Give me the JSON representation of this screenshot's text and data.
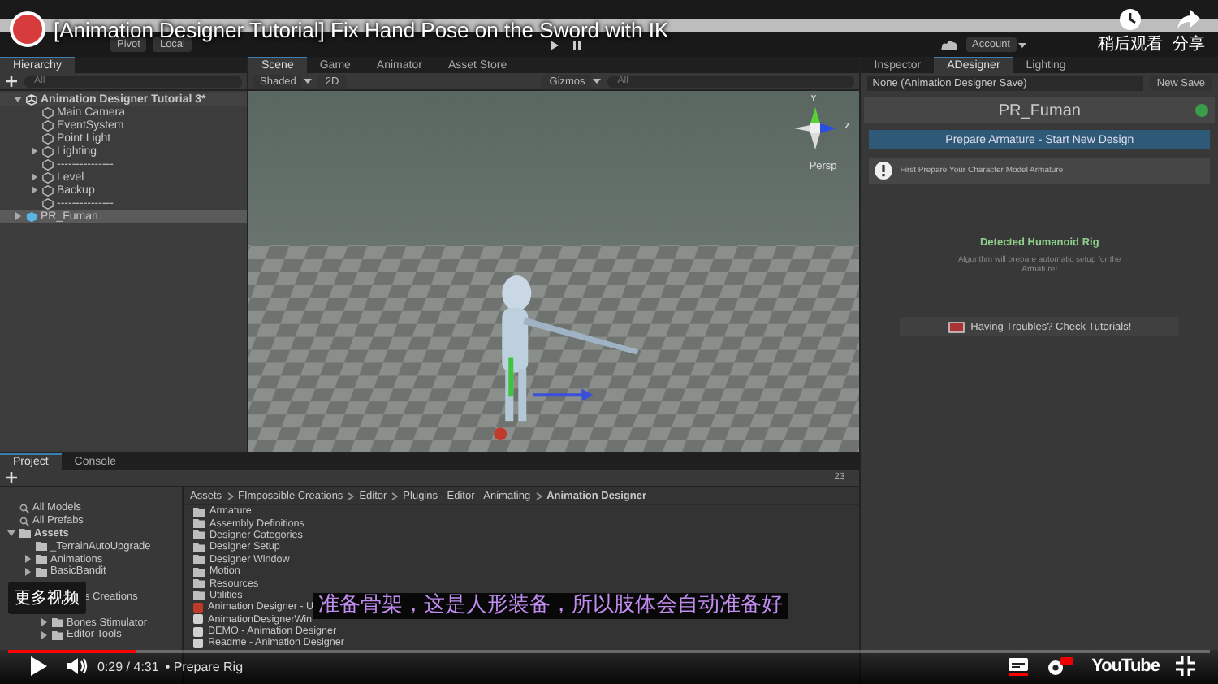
{
  "video_title": "[Animation Designer Tutorial] Fix Hand Pose on the Sword with IK",
  "top_actions": [
    {
      "kind": "watch_later",
      "label": "稍后观看"
    },
    {
      "kind": "share",
      "label": "分享"
    }
  ],
  "toolbar": {
    "pivot": "Pivot",
    "local": "Local",
    "account": "Account"
  },
  "hierarchy": {
    "tab": "Hierarchy",
    "search": "All",
    "items": [
      {
        "label": "Animation Designer Tutorial 3*",
        "kind": "scene",
        "expanded": true,
        "selected": false,
        "children": [
          {
            "label": "Main Camera",
            "kind": "object",
            "selected": false
          },
          {
            "label": "EventSystem",
            "kind": "object",
            "selected": false
          },
          {
            "label": "Point Light",
            "kind": "object",
            "selected": false
          },
          {
            "label": "Lighting",
            "kind": "object",
            "expanded": false,
            "selected": false
          },
          {
            "label": "---------------",
            "kind": "object",
            "selected": false
          },
          {
            "label": "Level",
            "kind": "object",
            "expanded": false,
            "selected": false
          },
          {
            "label": "Backup",
            "kind": "object",
            "expanded": false,
            "selected": false
          },
          {
            "label": "---------------",
            "kind": "object",
            "selected": false
          }
        ]
      },
      {
        "label": "PR_Fuman",
        "kind": "prefab",
        "expanded": false,
        "selected": true
      }
    ]
  },
  "scene": {
    "tabs": [
      {
        "label": "Scene",
        "selected": true
      },
      {
        "label": "Game",
        "selected": false
      },
      {
        "label": "Animator",
        "selected": false
      },
      {
        "label": "Asset Store",
        "selected": false
      }
    ],
    "shading": "Shaded",
    "mode_2d": "2D",
    "gizmos": "Gizmos",
    "search": "All",
    "axis_y": "Y",
    "axis_z": "Z",
    "projection": "Persp"
  },
  "inspector": {
    "tabs": [
      {
        "label": "Inspector",
        "selected": false
      },
      {
        "label": "ADesigner",
        "selected": true
      },
      {
        "label": "Lighting",
        "selected": false
      }
    ],
    "save_field": "None (Animation Designer Save)",
    "new_save": "New Save",
    "target": "PR_Fuman",
    "prepare_button": "Prepare Armature - Start New Design",
    "hint": "First Prepare Your Character Model Armature",
    "detected": "Detected Humanoid Rig",
    "detected_note": "Algorithm will prepare automatic setup for the Armature!",
    "tutorials_button": "Having Troubles? Check Tutorials!"
  },
  "project": {
    "tabs": [
      {
        "label": "Project",
        "selected": true
      },
      {
        "label": "Console",
        "selected": false
      }
    ],
    "count": "23",
    "tree": [
      {
        "label": "All Models",
        "kind": "search"
      },
      {
        "label": "All Prefabs",
        "kind": "search"
      },
      {
        "label": "Assets",
        "kind": "folder",
        "expanded": true,
        "children": [
          {
            "label": "_TerrainAutoUpgrade",
            "kind": "folder"
          },
          {
            "label": "Animations",
            "kind": "folder",
            "expanded": false
          },
          {
            "label": "BasicBandit",
            "kind": "folder",
            "expanded": false
          },
          {
            "kind": "covered"
          },
          {
            "label": "s Creations",
            "kind": "partly_covered",
            "children": [
              {
                "kind": "covered"
              },
              {
                "label": "Bones Stimulator",
                "kind": "folder",
                "expanded": false
              },
              {
                "label": "Editor Tools",
                "kind": "folder",
                "expanded": false
              }
            ]
          }
        ]
      }
    ],
    "breadcrumb": [
      "Assets",
      "FImpossible Creations",
      "Editor",
      "Plugins - Editor - Animating",
      "Animation Designer"
    ],
    "files": [
      {
        "label": "Armature",
        "kind": "folder"
      },
      {
        "label": "Assembly Definitions",
        "kind": "folder"
      },
      {
        "label": "Designer Categories",
        "kind": "folder"
      },
      {
        "label": "Designer Setup",
        "kind": "folder"
      },
      {
        "label": "Designer Window",
        "kind": "folder"
      },
      {
        "label": "Motion",
        "kind": "folder"
      },
      {
        "label": "Resources",
        "kind": "folder"
      },
      {
        "label": "Utilities",
        "kind": "folder"
      },
      {
        "label": "Animation Designer - U",
        "kind": "asset"
      },
      {
        "label": "AnimationDesignerWin",
        "kind": "script"
      },
      {
        "label": "DEMO - Animation Designer",
        "kind": "scene"
      },
      {
        "label": "Readme - Animation Designer",
        "kind": "doc"
      }
    ]
  },
  "player": {
    "subtitle": "准备骨架，这是人形装备，所以肢体会自动准备好",
    "more_videos": "更多视频",
    "progress": {
      "level": 0.107
    },
    "time": "0:29 / 4:31",
    "chapter": "• Prepare Rig",
    "logo": "YouTube",
    "playing": false
  }
}
